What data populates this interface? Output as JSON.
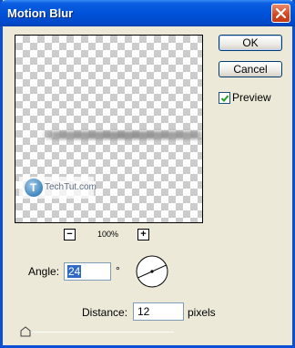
{
  "window": {
    "title": "Motion Blur"
  },
  "buttons": {
    "ok": "OK",
    "cancel": "Cancel"
  },
  "preview_toggle": {
    "label": "Preview",
    "checked": true
  },
  "preview": {
    "watermark_text": "TechTut.com",
    "watermark_logo_letter": "T"
  },
  "zoom": {
    "minus": "−",
    "plus": "+",
    "level": "100%"
  },
  "angle": {
    "label": "Angle:",
    "value": "24",
    "unit": "°"
  },
  "distance": {
    "label": "Distance:",
    "value": "12",
    "unit": "pixels",
    "slider_value": 12
  },
  "icons": {
    "close": "close-icon",
    "checkbox": "checkmark-icon",
    "dial": "angle-dial-icon",
    "slider": "slider-thumb-icon"
  }
}
